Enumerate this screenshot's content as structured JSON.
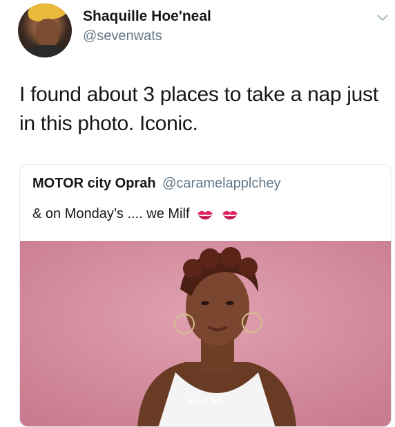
{
  "author": {
    "display_name": "Shaquille Hoe'neal",
    "handle": "@sevenwats"
  },
  "tweet": {
    "text": "I found about 3 places to take a nap just in this photo. Iconic."
  },
  "quoted_tweet": {
    "display_name": "MOTOR city Oprah",
    "handle": "@caramelapplchey",
    "text": "& on Monday’s .... we Milf",
    "emoji": [
      "kiss-mark-icon",
      "kiss-mark-icon"
    ]
  },
  "carousel": {
    "total": 5,
    "active_index": 4
  },
  "colors": {
    "text_primary": "#14171a",
    "text_secondary": "#657786",
    "border": "#e1e8ed",
    "photo_background": "#d58ea0"
  }
}
